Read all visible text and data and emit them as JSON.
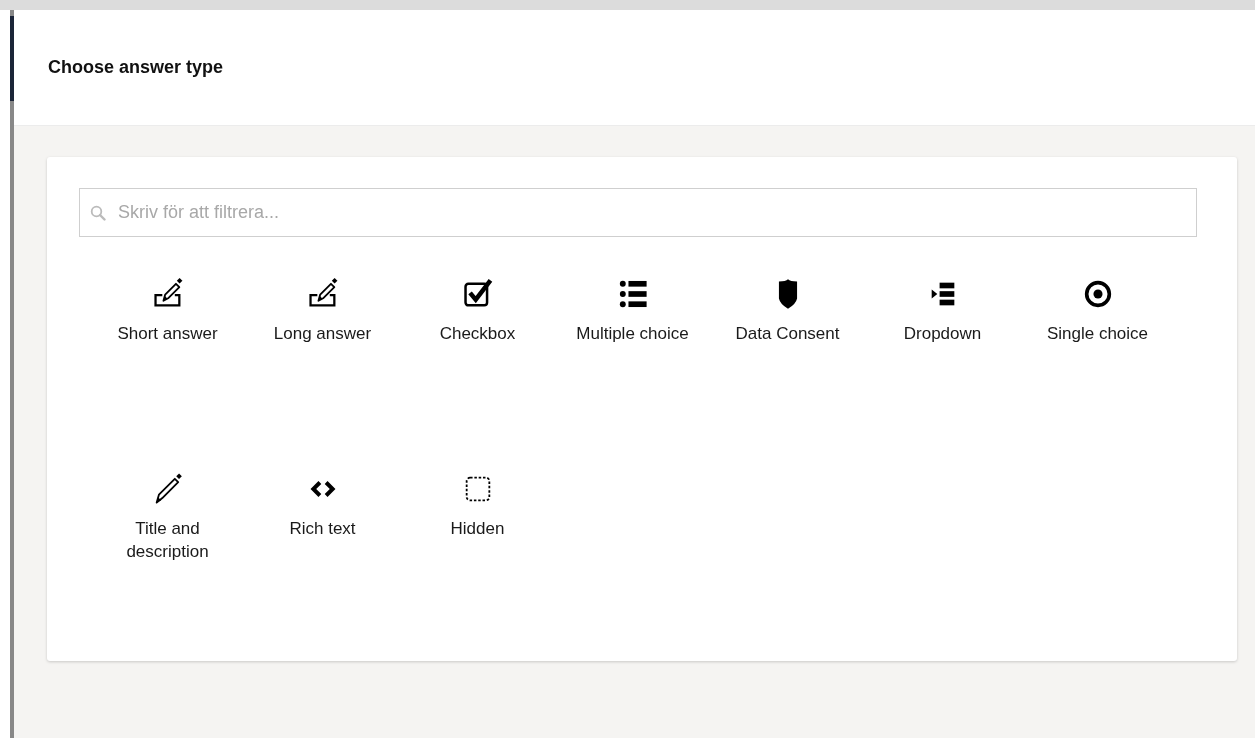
{
  "dialog": {
    "title": "Choose answer type"
  },
  "search": {
    "placeholder": "Skriv för att filtrera..."
  },
  "answer_types": [
    {
      "kind": "shortanswer",
      "label": "Short answer"
    },
    {
      "kind": "longanswer",
      "label": "Long answer"
    },
    {
      "kind": "checkbox",
      "label": "Checkbox"
    },
    {
      "kind": "list",
      "label": "Multiple choice"
    },
    {
      "kind": "consent",
      "label": "Data Consent"
    },
    {
      "kind": "dropdown",
      "label": "Dropdown"
    },
    {
      "kind": "radio",
      "label": "Single choice"
    },
    {
      "kind": "pencil",
      "label": "Title and description"
    },
    {
      "kind": "code",
      "label": "Rich text"
    },
    {
      "kind": "hidden",
      "label": "Hidden"
    }
  ]
}
